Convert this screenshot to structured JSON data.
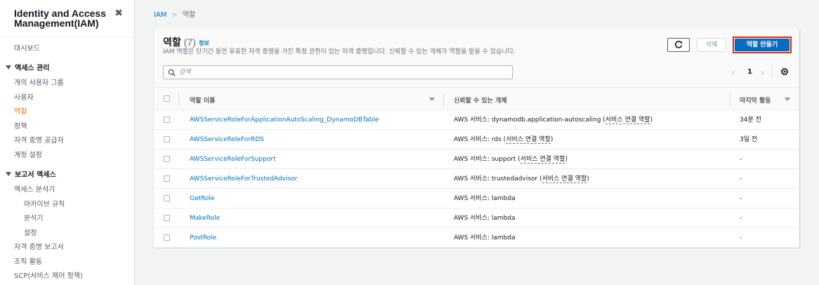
{
  "sidebar": {
    "title": "Identity and Access Management(IAM)",
    "close_glyph": "✖",
    "items": [
      {
        "label": "대시보드"
      },
      {
        "label": "액세스 관리"
      },
      {
        "label": "개의 사용자 그룹"
      },
      {
        "label": "사용자"
      },
      {
        "label": "역할"
      },
      {
        "label": "정책"
      },
      {
        "label": "자격 증명 공급자"
      },
      {
        "label": "계정 설정"
      },
      {
        "label": "보고서 액세스"
      },
      {
        "label": "액세스 분석기"
      },
      {
        "label": "아카이브 규칙"
      },
      {
        "label": "분석기"
      },
      {
        "label": "설정"
      },
      {
        "label": "자격 증명 보고서"
      },
      {
        "label": "조직 활동"
      },
      {
        "label": "SCP(서비스 제어 정책)"
      }
    ]
  },
  "breadcrumb": {
    "root": "IAM",
    "separator": ">",
    "current": "역할"
  },
  "panel": {
    "title": "역할",
    "count": "(7)",
    "info_link": "정보",
    "description": "IAM 역할은 단기간 동안 유효한 자격 증명을 가진 특정 권한이 있는 자격 증명입니다. 신뢰할 수 있는 개체가 역할을 맡을 수 있습니다.",
    "search_placeholder": "검색",
    "delete_label": "삭제",
    "create_label": "역할 만들기",
    "page_prev": "‹",
    "page_current": "1",
    "page_next": "›"
  },
  "table": {
    "columns": [
      "역할 이름",
      "신뢰할 수 있는 개체",
      "마지막 활동"
    ],
    "rows": [
      {
        "name": "AWSServiceRoleForApplicationAutoScaling_DynamoDBTable",
        "trusted_prefix": "AWS 서비스: dynamodb.application-autoscaling (",
        "trusted_link": "서비스 연결 역할",
        "trusted_suffix": ")",
        "activity": "34분 전"
      },
      {
        "name": "AWSServiceRoleForRDS",
        "trusted_prefix": "AWS 서비스: rds (",
        "trusted_link": "서비스 연결 역할",
        "trusted_suffix": ")",
        "activity": "3일 전"
      },
      {
        "name": "AWSServiceRoleForSupport",
        "trusted_prefix": "AWS 서비스: support (",
        "trusted_link": "서비스 연결 역할",
        "trusted_suffix": ")",
        "activity": "-"
      },
      {
        "name": "AWSServiceRoleForTrustedAdvisor",
        "trusted_prefix": "AWS 서비스: trustedadvisor (",
        "trusted_link": "서비스 연결 역할",
        "trusted_suffix": ")",
        "activity": "-"
      },
      {
        "name": "GetRole",
        "trusted_prefix": "AWS 서비스: lambda",
        "trusted_link": "",
        "trusted_suffix": "",
        "activity": "-"
      },
      {
        "name": "MakeRole",
        "trusted_prefix": "AWS 서비스: lambda",
        "trusted_link": "",
        "trusted_suffix": "",
        "activity": "-"
      },
      {
        "name": "PostRole",
        "trusted_prefix": "AWS 서비스: lambda",
        "trusted_link": "",
        "trusted_suffix": "",
        "activity": "-"
      }
    ]
  },
  "icons": [
    "close-icon",
    "caret-down-icon",
    "refresh-icon",
    "search-icon",
    "chevron-left-icon",
    "chevron-right-icon",
    "gear-icon",
    "sort-caret-icon"
  ],
  "colors": {
    "link": "#0073bb",
    "active_nav": "#ec7211",
    "primary_button": "#0a6dc4",
    "highlight_border": "#d13212"
  }
}
